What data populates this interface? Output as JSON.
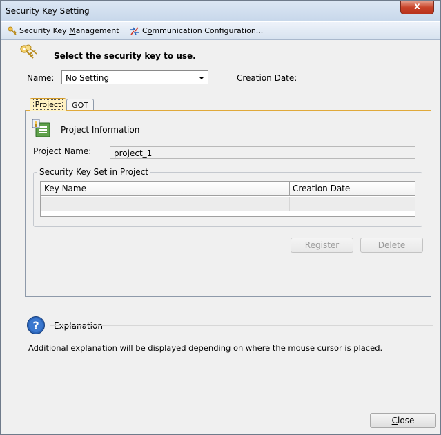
{
  "window": {
    "title": "Security Key Setting",
    "close_label": "x"
  },
  "toolbar": {
    "management_prefix": "Security Key ",
    "management_mnemonic": "M",
    "management_suffix": "anagement",
    "communication_prefix": "C",
    "communication_mnemonic": "o",
    "communication_suffix": "mmunication Configuration..."
  },
  "header": {
    "instruction": "Select the security key to use.",
    "name_label": "Name:",
    "name_value": "No Setting",
    "creation_date_label": "Creation Date:",
    "creation_date_value": ""
  },
  "tabs": [
    {
      "label": "Project",
      "active": true
    },
    {
      "label": "GOT",
      "active": false
    }
  ],
  "project": {
    "section_title": "Project Information",
    "name_label": "Project Name:",
    "name_value": "project_1",
    "group_title": "Security Key Set in Project",
    "columns": [
      "Key Name",
      "Creation Date"
    ],
    "rows": [
      [
        "",
        ""
      ]
    ]
  },
  "buttons": {
    "register_prefix": "Reg",
    "register_mnemonic": "i",
    "register_suffix": "ster",
    "delete_mnemonic": "D",
    "delete_suffix": "elete",
    "close_mnemonic": "C",
    "close_suffix": "lose"
  },
  "explanation": {
    "title": "Explanation",
    "text": "Additional explanation will be displayed depending on where the mouse cursor is placed."
  },
  "colors": {
    "active_tab_bg": "#fff2c2",
    "active_tab_border": "#e0a93a",
    "title_bar": "#c7d7ea",
    "close_button": "#c9442a"
  }
}
